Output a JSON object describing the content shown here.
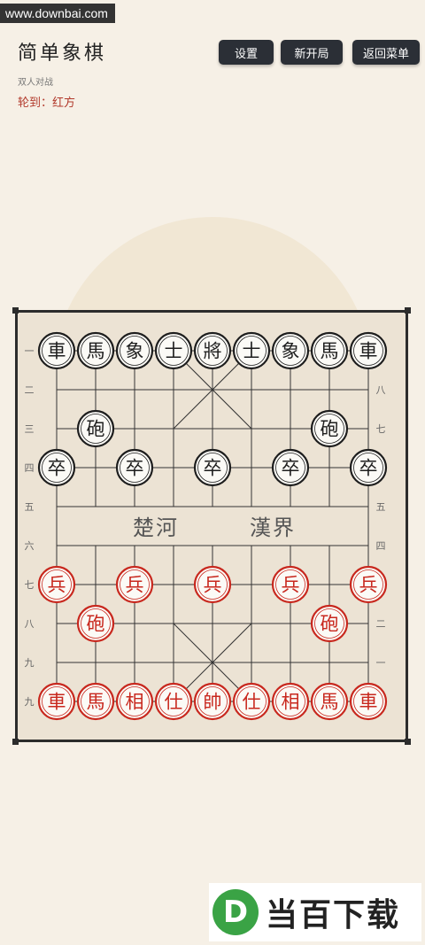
{
  "watermark_top": "www.downbai.com",
  "header": {
    "title": "简单象棋",
    "subtitle": "双人对战",
    "turn": "轮到：红方"
  },
  "buttons": {
    "settings": "设置",
    "new_game": "新开局",
    "back_menu": "返回菜单"
  },
  "board": {
    "river_left": "楚河",
    "river_right": "漢界",
    "black_coords": [
      "一",
      "二",
      "三",
      "四",
      "五",
      "六",
      "七",
      "八",
      "九"
    ],
    "red_coords": [
      "九",
      "八",
      "七",
      "六",
      "五",
      "四",
      "三",
      "二",
      "一"
    ],
    "left_labels": [
      "一",
      "二",
      "三",
      "四",
      "五",
      "六",
      "七",
      "八",
      "九",
      "九"
    ],
    "right_labels": [
      "",
      "八",
      "七",
      "",
      "五",
      "四",
      "",
      "二",
      "一",
      ""
    ],
    "pieces": [
      {
        "side": "black",
        "char": "車",
        "file": 0,
        "rank": 0
      },
      {
        "side": "black",
        "char": "馬",
        "file": 1,
        "rank": 0
      },
      {
        "side": "black",
        "char": "象",
        "file": 2,
        "rank": 0
      },
      {
        "side": "black",
        "char": "士",
        "file": 3,
        "rank": 0
      },
      {
        "side": "black",
        "char": "將",
        "file": 4,
        "rank": 0
      },
      {
        "side": "black",
        "char": "士",
        "file": 5,
        "rank": 0
      },
      {
        "side": "black",
        "char": "象",
        "file": 6,
        "rank": 0
      },
      {
        "side": "black",
        "char": "馬",
        "file": 7,
        "rank": 0
      },
      {
        "side": "black",
        "char": "車",
        "file": 8,
        "rank": 0
      },
      {
        "side": "black",
        "char": "砲",
        "file": 1,
        "rank": 2
      },
      {
        "side": "black",
        "char": "砲",
        "file": 7,
        "rank": 2
      },
      {
        "side": "black",
        "char": "卒",
        "file": 0,
        "rank": 3
      },
      {
        "side": "black",
        "char": "卒",
        "file": 2,
        "rank": 3
      },
      {
        "side": "black",
        "char": "卒",
        "file": 4,
        "rank": 3
      },
      {
        "side": "black",
        "char": "卒",
        "file": 6,
        "rank": 3
      },
      {
        "side": "black",
        "char": "卒",
        "file": 8,
        "rank": 3
      },
      {
        "side": "red",
        "char": "兵",
        "file": 0,
        "rank": 6
      },
      {
        "side": "red",
        "char": "兵",
        "file": 2,
        "rank": 6
      },
      {
        "side": "red",
        "char": "兵",
        "file": 4,
        "rank": 6
      },
      {
        "side": "red",
        "char": "兵",
        "file": 6,
        "rank": 6
      },
      {
        "side": "red",
        "char": "兵",
        "file": 8,
        "rank": 6
      },
      {
        "side": "red",
        "char": "砲",
        "file": 1,
        "rank": 7
      },
      {
        "side": "red",
        "char": "砲",
        "file": 7,
        "rank": 7
      },
      {
        "side": "red",
        "char": "車",
        "file": 0,
        "rank": 9
      },
      {
        "side": "red",
        "char": "馬",
        "file": 1,
        "rank": 9
      },
      {
        "side": "red",
        "char": "相",
        "file": 2,
        "rank": 9
      },
      {
        "side": "red",
        "char": "仕",
        "file": 3,
        "rank": 9
      },
      {
        "side": "red",
        "char": "帥",
        "file": 4,
        "rank": 9
      },
      {
        "side": "red",
        "char": "仕",
        "file": 5,
        "rank": 9
      },
      {
        "side": "red",
        "char": "相",
        "file": 6,
        "rank": 9
      },
      {
        "side": "red",
        "char": "馬",
        "file": 7,
        "rank": 9
      },
      {
        "side": "red",
        "char": "車",
        "file": 8,
        "rank": 9
      }
    ]
  },
  "colors": {
    "red": "#c8281e",
    "black": "#1e1e1e",
    "line": "#333333",
    "board": "#ece3d4"
  },
  "watermark_bottom": {
    "logo": "D",
    "text": "当百下载"
  }
}
